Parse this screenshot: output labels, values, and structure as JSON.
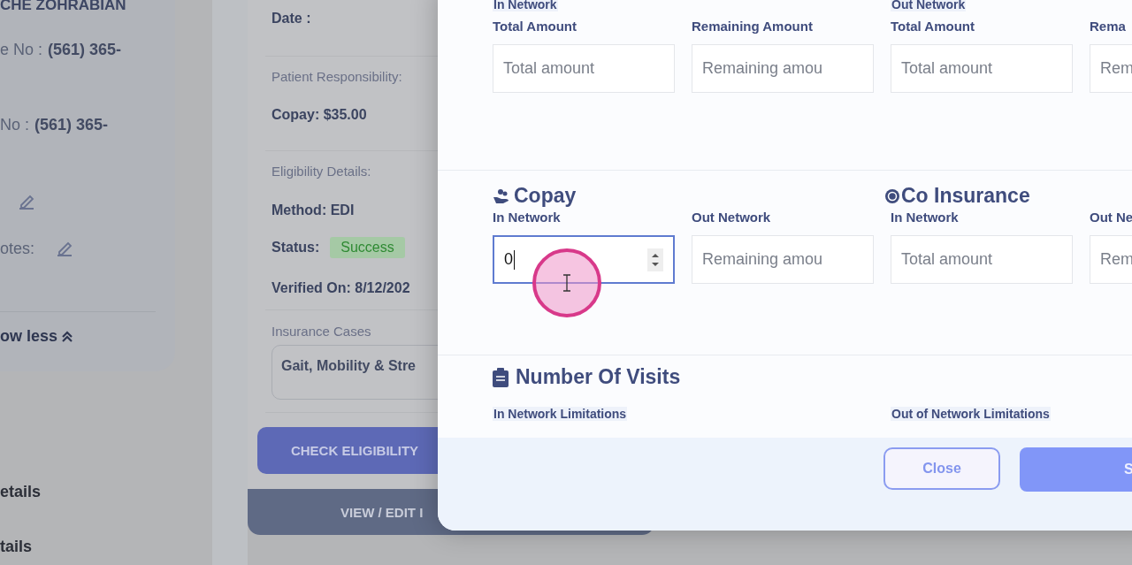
{
  "background": {
    "patient_card": {
      "name": "CHE ZOHRABIAN",
      "phones": [
        {
          "label": "e No :",
          "value": "(561) 365-"
        },
        {
          "label": "No :",
          "value": "(561) 365-"
        }
      ],
      "notes_label": "otes:",
      "show_less": "ow less"
    },
    "nav_items": [
      "etails",
      "tails"
    ],
    "eligibility_card": {
      "date_label": "Date :",
      "responsibility_label": "Patient Responsibility:",
      "copay": "Copay: $35.00",
      "details_label": "Eligibility Details:",
      "method": "Method: EDI",
      "status_label": "Status:",
      "status": "Success",
      "verified": "Verified On: 8/12/202",
      "cases_label": "Insurance Cases",
      "cases_value": "Gait, Mobility & Stre",
      "check_button": "CHECK ELIGIBILITY",
      "view_button": "VIEW / EDIT I"
    }
  },
  "modal": {
    "amounts": {
      "groups": [
        "In Network",
        "Out Network"
      ],
      "fields": [
        {
          "label": "Total Amount",
          "placeholder": "Total amount",
          "focused": false
        },
        {
          "label": "Remaining Amount",
          "placeholder": "Remaining amou",
          "focused": false
        },
        {
          "label": "Total Amount",
          "placeholder": "Total amount",
          "focused": false
        },
        {
          "label": "Rema",
          "placeholder": "Rem",
          "focused": false
        }
      ]
    },
    "copay": {
      "title": "Copay",
      "fields": [
        {
          "label": "In Network",
          "value": "0",
          "focused": true
        },
        {
          "label": "Out Network",
          "placeholder": "Remaining amou",
          "focused": false
        }
      ]
    },
    "co_insurance": {
      "title": "Co Insurance",
      "fields": [
        {
          "label": "In Network",
          "placeholder": "Total amount",
          "focused": false
        },
        {
          "label": "Out Ne",
          "placeholder": "Rem",
          "focused": false
        }
      ]
    },
    "visits": {
      "title": "Number Of Visits",
      "groups": [
        "In Network Limitations",
        "Out of Network Limitations"
      ]
    },
    "footer": {
      "buttons": [
        {
          "label": "Close",
          "kind": "secondary"
        },
        {
          "label": "S",
          "kind": "primary"
        }
      ]
    }
  }
}
